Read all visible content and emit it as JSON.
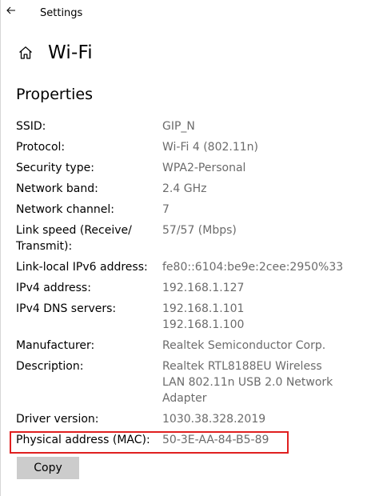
{
  "window": {
    "app_title": "Settings",
    "back_icon": "back-arrow-icon",
    "home_icon": "home-icon"
  },
  "header": {
    "title": "Wi-Fi"
  },
  "section": {
    "title": "Properties"
  },
  "properties": [
    {
      "label": "SSID:",
      "value": [
        "GIP_N"
      ]
    },
    {
      "label": "Protocol:",
      "value": [
        "Wi-Fi 4 (802.11n)"
      ]
    },
    {
      "label": "Security type:",
      "value": [
        "WPA2-Personal"
      ]
    },
    {
      "label": "Network band:",
      "value": [
        "2.4 GHz"
      ]
    },
    {
      "label": "Network channel:",
      "value": [
        "7"
      ]
    },
    {
      "label": "Link speed (Receive/ Transmit):",
      "label_lines": [
        "Link speed (Receive/",
        "Transmit):"
      ],
      "value": [
        "57/57 (Mbps)"
      ]
    },
    {
      "label": "Link-local IPv6 address:",
      "value": [
        "fe80::6104:be9e:2cee:2950%33"
      ]
    },
    {
      "label": "IPv4 address:",
      "value": [
        "192.168.1.127"
      ]
    },
    {
      "label": "IPv4 DNS servers:",
      "value": [
        "192.168.1.101",
        "192.168.1.100"
      ]
    },
    {
      "label": "Manufacturer:",
      "value": [
        "Realtek Semiconductor Corp."
      ]
    },
    {
      "label": "Description:",
      "value": [
        "Realtek RTL8188EU Wireless",
        "LAN 802.11n USB 2.0 Network",
        "Adapter"
      ]
    },
    {
      "label": "Driver version:",
      "value": [
        "1030.38.328.2019"
      ]
    },
    {
      "label": "Physical address (MAC):",
      "value": [
        "50-3E-AA-84-B5-89"
      ],
      "highlighted": true
    }
  ],
  "actions": {
    "copy_label": "Copy"
  },
  "colors": {
    "highlight": "#e02020",
    "value_text": "#6b6b6b",
    "button_bg": "#cccccc"
  }
}
